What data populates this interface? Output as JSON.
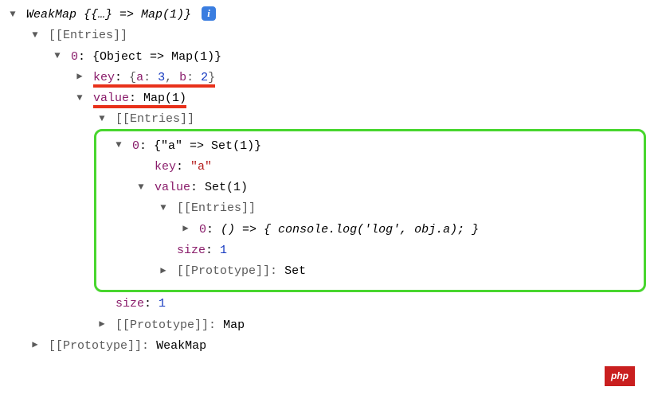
{
  "root": {
    "summary_prefix": "WeakMap ",
    "summary_inner": "{{…} => Map(1)}"
  },
  "entries_label": "[[Entries]]",
  "idx0_label": "0",
  "idx0_value": "{Object => Map(1)}",
  "key_label": "key",
  "key_value_obj": {
    "open": "{",
    "a_k": "a",
    "a_v": "3",
    "sep": ", ",
    "b_k": "b",
    "b_v": "2",
    "close": "}"
  },
  "value_label": "value",
  "value_map": "Map(1)",
  "inner": {
    "idx": "0",
    "summary": "{\"a\" => Set(1)}",
    "key_label": "key",
    "key_value": "\"a\"",
    "value_label": "value",
    "set_label": "Set(1)",
    "entries_label": "[[Entries]]",
    "fn_idx": "0",
    "fn_body": "() => { console.log('log', obj.a); }",
    "size_label": "size",
    "size_value": "1",
    "proto_label": "[[Prototype]]",
    "proto_val": "Set"
  },
  "outer_size_label": "size",
  "outer_size_value": "1",
  "outer_proto_label": "[[Prototype]]",
  "outer_proto_val": "Map",
  "root_proto_label": "[[Prototype]]",
  "root_proto_val": "WeakMap",
  "watermark": "php"
}
